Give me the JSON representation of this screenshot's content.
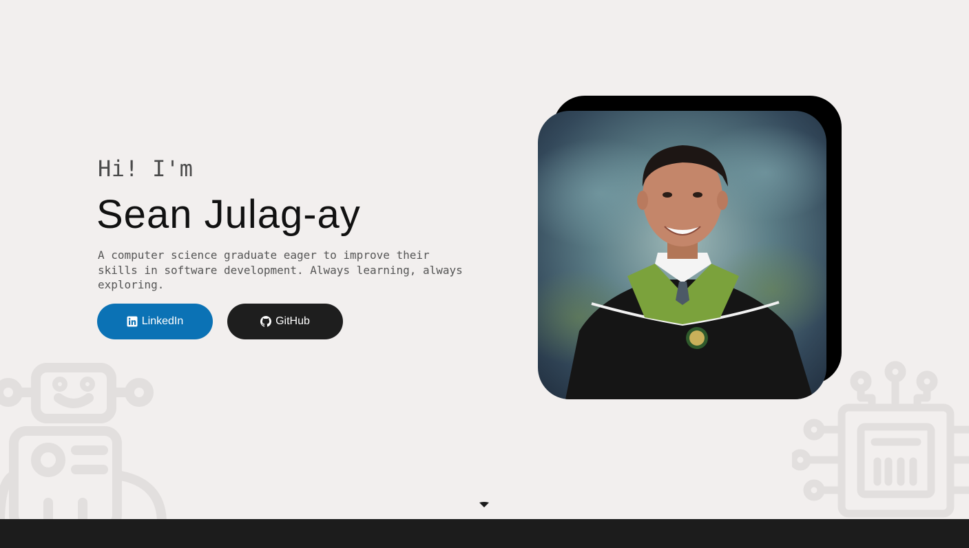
{
  "hero": {
    "greeting": "Hi! I'm",
    "name": "Sean Julag-ay",
    "description": "A computer science graduate eager to improve their skills in software development. Always learning, always exploring.",
    "buttons": {
      "linkedin_label": "LinkedIn",
      "github_label": "GitHub"
    },
    "photo_alt": "Graduation portrait"
  },
  "icons": {
    "linkedin": "linkedin-icon",
    "github": "github-icon",
    "scroll_down": "caret-down-icon",
    "robot_decoration": "robot-icon",
    "chip_decoration": "circuit-chip-icon"
  },
  "colors": {
    "background": "#f2efee",
    "linkedin_button": "#0b72b5",
    "github_button": "#1e1e1e",
    "photo_frame_shadow": "#000000",
    "footer": "#1c1c1c"
  }
}
